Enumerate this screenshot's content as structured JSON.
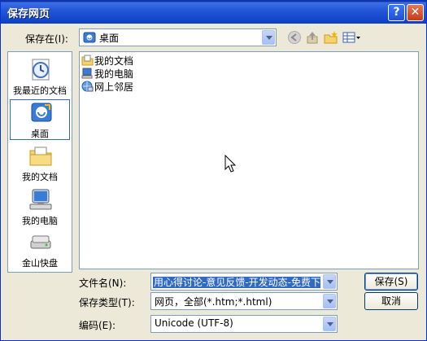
{
  "window": {
    "title": "保存网页",
    "help": "?",
    "close": "✕"
  },
  "savein": {
    "label": "保存在(I):",
    "value": "桌面"
  },
  "places": [
    {
      "label": "我最近的文档",
      "icon": "recent-documents-icon"
    },
    {
      "label": "桌面",
      "icon": "desktop-icon"
    },
    {
      "label": "我的文档",
      "icon": "my-documents-icon"
    },
    {
      "label": "我的电脑",
      "icon": "my-computer-icon"
    },
    {
      "label": "金山快盘",
      "icon": "cloud-drive-icon"
    }
  ],
  "files": [
    {
      "label": "我的文档",
      "icon": "my-documents-icon"
    },
    {
      "label": "我的电脑",
      "icon": "my-computer-icon"
    },
    {
      "label": "网上邻居",
      "icon": "network-places-icon"
    }
  ],
  "form": {
    "filename_label": "文件名(N):",
    "filename_value": "用心得讨论-意见反馈-开发动态-免费下载",
    "filetype_label": "保存类型(T):",
    "filetype_value": "网页，全部(*.htm;*.html)",
    "encoding_label": "编码(E):",
    "encoding_value": "Unicode (UTF-8)"
  },
  "buttons": {
    "save": "保存(S)",
    "cancel": "取消"
  }
}
